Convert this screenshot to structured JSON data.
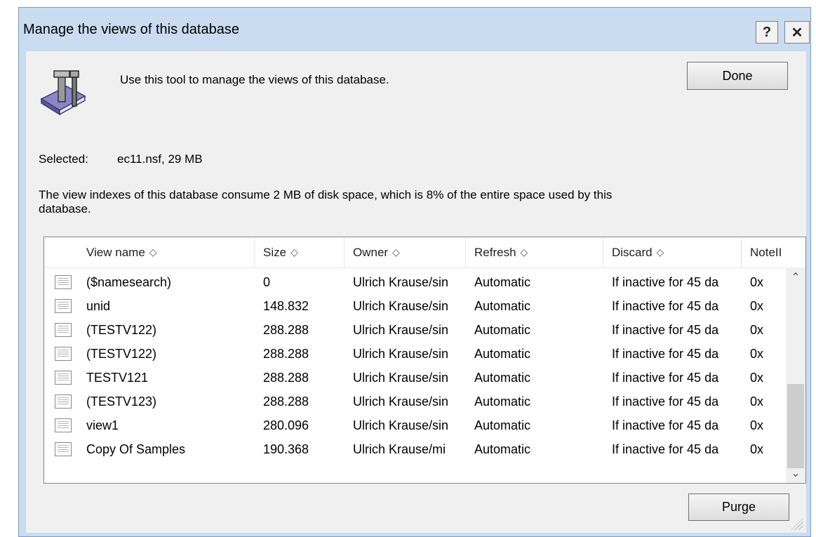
{
  "window": {
    "title": "Manage the views of this database",
    "help_glyph": "?",
    "close_glyph": "✕"
  },
  "intro": {
    "icon": "tools-book-icon",
    "text": "Use this tool to manage the views of this database."
  },
  "buttons": {
    "done_label": "Done",
    "purge_label": "Purge"
  },
  "selected": {
    "label": "Selected:",
    "value": "ec11.nsf, 29 MB"
  },
  "description": "The view indexes of this database consume 2 MB of disk space, which is 8% of the entire space used by this database.",
  "table": {
    "sort_glyph": "◇",
    "columns": [
      "View name",
      "Size",
      "Owner",
      "Refresh",
      "Discard",
      "NoteII"
    ],
    "rows": [
      {
        "name": "($namesearch)",
        "size": "0",
        "owner": "Ulrich Krause/sin",
        "refresh": "Automatic",
        "discard": "If inactive for 45 da",
        "noteid": "0x"
      },
      {
        "name": "unid",
        "size": "148.832",
        "owner": "Ulrich Krause/sin",
        "refresh": "Automatic",
        "discard": "If inactive for 45 da",
        "noteid": "0x"
      },
      {
        "name": "(TESTV122)",
        "size": "288.288",
        "owner": "Ulrich Krause/sin",
        "refresh": "Automatic",
        "discard": "If inactive for 45 da",
        "noteid": "0x"
      },
      {
        "name": "(TESTV122)",
        "size": "288.288",
        "owner": "Ulrich Krause/sin",
        "refresh": "Automatic",
        "discard": "If inactive for 45 da",
        "noteid": "0x"
      },
      {
        "name": "TESTV121",
        "size": "288.288",
        "owner": "Ulrich Krause/sin",
        "refresh": "Automatic",
        "discard": "If inactive for 45 da",
        "noteid": "0x"
      },
      {
        "name": "(TESTV123)",
        "size": "288.288",
        "owner": "Ulrich Krause/sin",
        "refresh": "Automatic",
        "discard": "If inactive for 45 da",
        "noteid": "0x"
      },
      {
        "name": "view1",
        "size": "280.096",
        "owner": "Ulrich Krause/sin",
        "refresh": "Automatic",
        "discard": "If inactive for 45 da",
        "noteid": "0x"
      },
      {
        "name": "Copy Of Samples",
        "size": "190.368",
        "owner": "Ulrich Krause/mi",
        "refresh": "Automatic",
        "discard": "If inactive for 45 da",
        "noteid": "0x"
      }
    ]
  },
  "scrollbar": {
    "up_glyph": "⌃",
    "down_glyph": "⌄"
  }
}
